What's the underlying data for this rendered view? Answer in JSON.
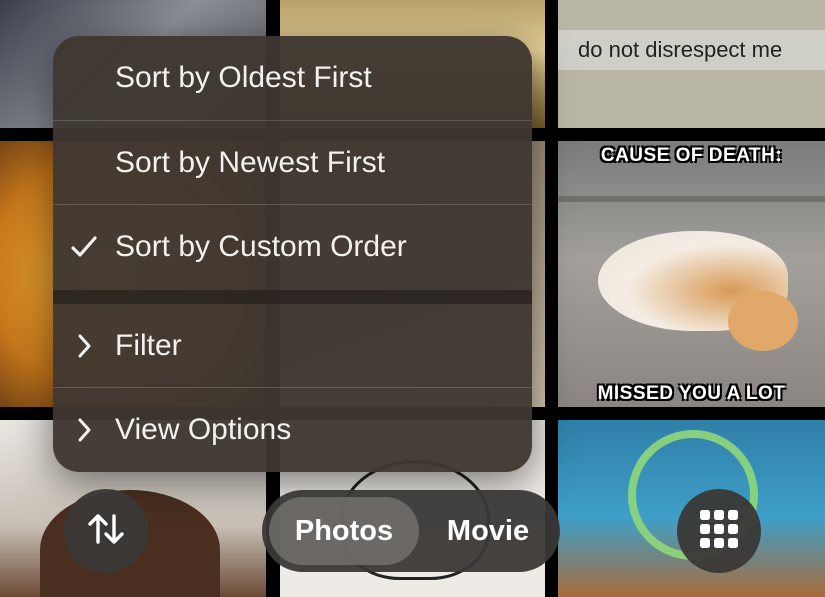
{
  "background": {
    "meme_top_text": "do not disrespect me",
    "meme_cat_top": "CAUSE OF DEATH:",
    "meme_cat_bottom": "MISSED YOU A LOT"
  },
  "menu": {
    "items": [
      {
        "label": "Sort by Oldest First",
        "lead_icon": "none",
        "checked": false
      },
      {
        "label": "Sort by Newest First",
        "lead_icon": "none",
        "checked": false
      },
      {
        "label": "Sort by Custom Order",
        "lead_icon": "checkmark-icon",
        "checked": true
      },
      {
        "label": "Filter",
        "lead_icon": "chevron-right-icon",
        "checked": false
      },
      {
        "label": "View Options",
        "lead_icon": "chevron-right-icon",
        "checked": false
      }
    ]
  },
  "toolbar": {
    "sort_icon": "sort-arrows-icon",
    "segments": {
      "photos": "Photos",
      "movie": "Movie"
    },
    "selected_segment": "Photos",
    "grid_icon": "grid-icon"
  }
}
